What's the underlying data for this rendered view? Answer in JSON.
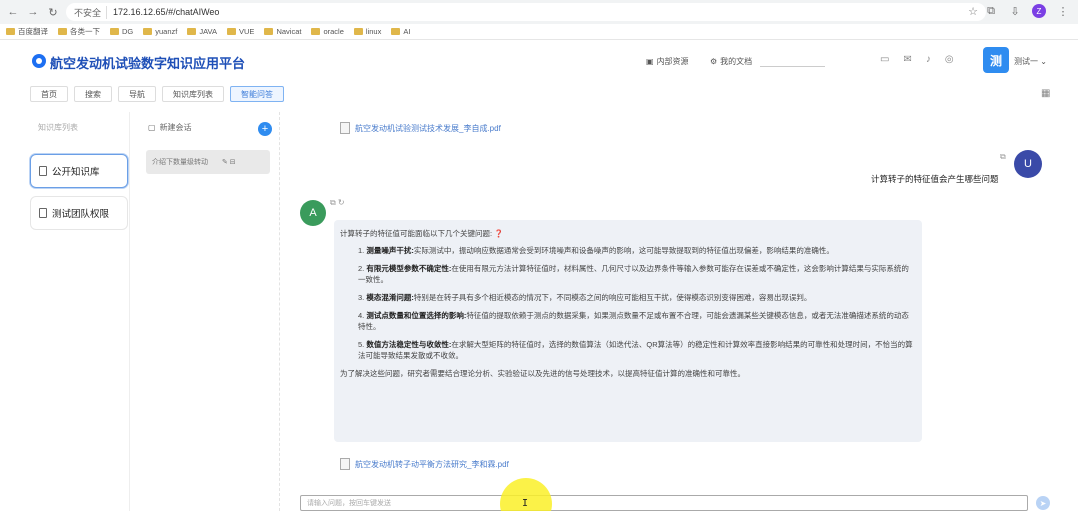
{
  "browser": {
    "insecure_label": "不安全",
    "url": "172.16.12.65/#/chatAIWeo",
    "bookmarks": [
      "百度翻译",
      "各类一下",
      "DG",
      "yuanzf",
      "JAVA",
      "VUE",
      "Navicat",
      "oracle",
      "linux",
      "AI"
    ],
    "profile_initial": "Z"
  },
  "header": {
    "title": "航空发动机试验数字知识应用平台",
    "link_docs": "内部资源",
    "link_mine": "我的文档",
    "avatar_text": "测",
    "user_name": "测试一"
  },
  "tabs": [
    {
      "label": "首页",
      "active": false
    },
    {
      "label": "搜索",
      "active": false
    },
    {
      "label": "导航",
      "active": false
    },
    {
      "label": "知识库列表",
      "active": false
    },
    {
      "label": "智能问答",
      "active": true
    }
  ],
  "left": {
    "header": "知识库列表",
    "items": [
      {
        "label": "公开知识库",
        "active": true
      },
      {
        "label": "测试团队权限",
        "active": false
      }
    ]
  },
  "middle": {
    "header": "新建会话",
    "add_label": "+",
    "conversation": "介绍下数量级转动"
  },
  "chat": {
    "file_top": "航空发动机试验测试技术发展_李自成.pdf",
    "user_initial": "U",
    "user_question": "计算转子的特征值会产生哪些问题",
    "bot_initial": "A",
    "answer_intro": "计算转子的特征值可能面临以下几个关键问题:",
    "answer_items": [
      {
        "num": "1.",
        "title": "测量噪声干扰:",
        "text": "实际测试中，振动响应数据通常会受到环境噪声和设备噪声的影响，这可能导致提取到的特征值出现偏差，影响结果的准确性。"
      },
      {
        "num": "2.",
        "title": "有限元模型参数不确定性:",
        "text": "在使用有限元方法计算特征值时，材料属性、几何尺寸以及边界条件等输入参数可能存在误差或不确定性，这会影响计算结果与实际系统的一致性。"
      },
      {
        "num": "3.",
        "title": "模态混淆问题:",
        "text": "特别是在转子具有多个相近模态的情况下，不同模态之间的响应可能相互干扰，使得模态识别变得困难，容易出现误判。"
      },
      {
        "num": "4.",
        "title": "测试点数量和位置选择的影响:",
        "text": "特征值的提取依赖于测点的数据采集，如果测点数量不足或布置不合理，可能会遗漏某些关键模态信息，或者无法准确描述系统的动态特性。"
      },
      {
        "num": "5.",
        "title": "数值方法稳定性与收敛性:",
        "text": "在求解大型矩阵的特征值时，选择的数值算法（如迭代法、QR算法等）的稳定性和计算效率直接影响结果的可靠性和处理时间，不恰当的算法可能导致结果发散或不收敛。"
      }
    ],
    "answer_outro": "为了解决这些问题，研究者需要结合理论分析、实验验证以及先进的信号处理技术，以提高特征值计算的准确性和可靠性。",
    "file_bottom": "航空发动机转子动平衡方法研究_李和霖.pdf",
    "input_placeholder": "请输入问题，按回车键发送",
    "send_label": "➤",
    "cursor_label": "I"
  }
}
